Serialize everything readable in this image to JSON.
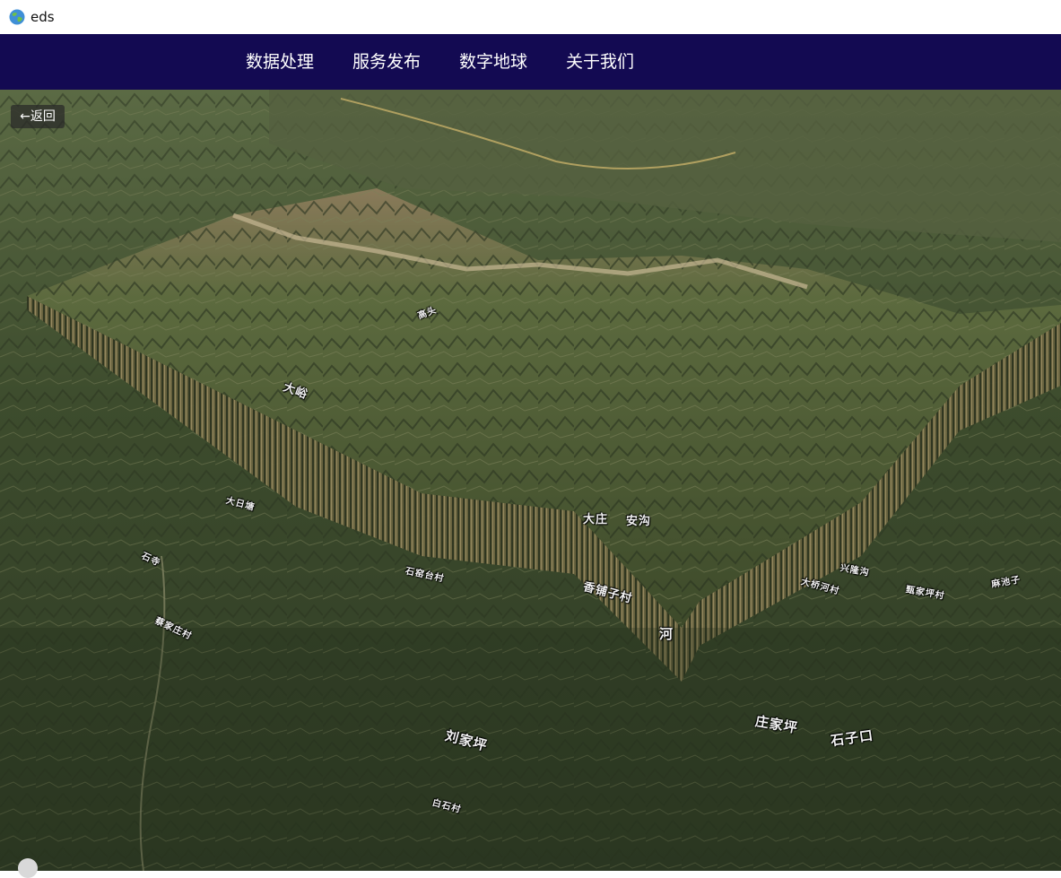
{
  "window": {
    "title": "eds",
    "icon": "globe-icon"
  },
  "nav": {
    "items": [
      "数据处理",
      "服务发布",
      "数字地球",
      "关于我们"
    ]
  },
  "map": {
    "back_label": "←返回",
    "place_labels": [
      "大峪",
      "大庄",
      "安沟",
      "香铺子村",
      "石窑台村",
      "河",
      "刘家坪",
      "庄家坪",
      "石子口",
      "大桥河村",
      "兴隆沟",
      "甄家坪村",
      "麻池子",
      "蔡家庄村",
      "白石村",
      "大日塘",
      "高头",
      "石寺"
    ],
    "colors": {
      "nav_bg": "#130a52",
      "terrain": "#4a5a35"
    }
  }
}
